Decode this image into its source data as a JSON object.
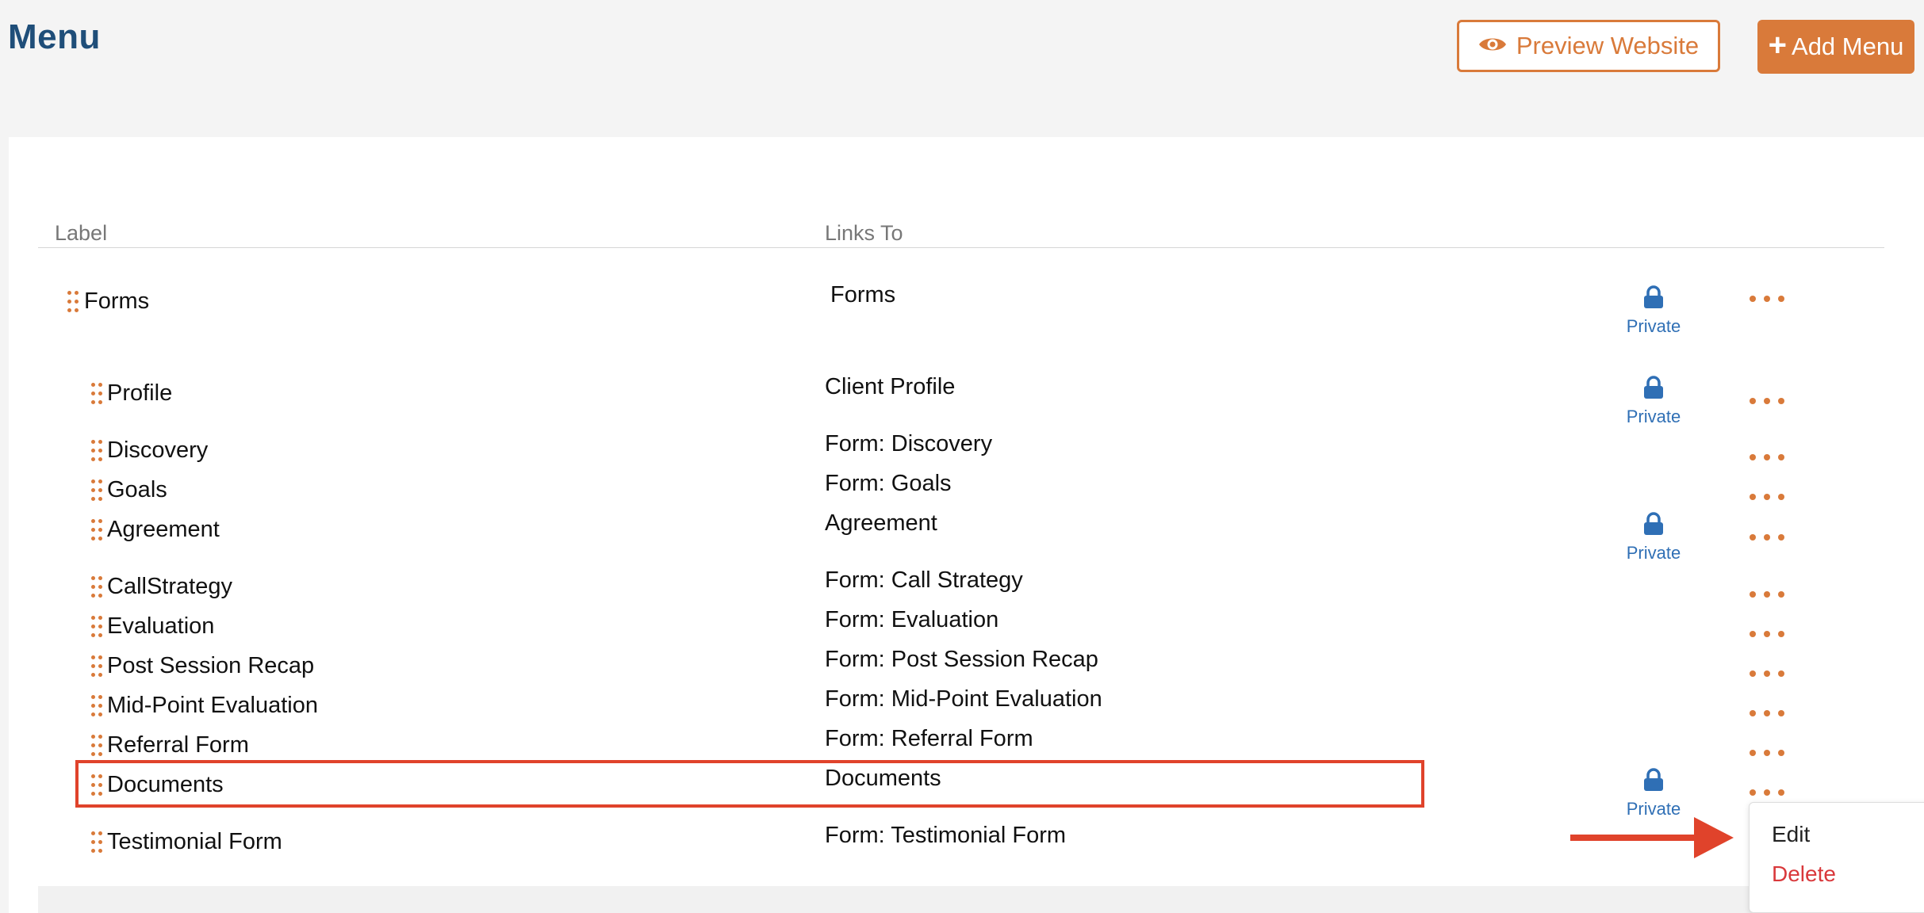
{
  "page": {
    "title": "Menu"
  },
  "header": {
    "preview_label": "Preview Website",
    "add_label": "Add Menu",
    "add_symbol": "+"
  },
  "table": {
    "columns": {
      "label": "Label",
      "links_to": "Links To"
    },
    "private_label": "Private",
    "rows": [
      {
        "label": "Forms",
        "links_to": "Forms",
        "private": true
      },
      {
        "label": "Profile",
        "links_to": "Client Profile",
        "private": true
      },
      {
        "label": "Discovery",
        "links_to": "Form: Discovery",
        "private": false
      },
      {
        "label": "Goals",
        "links_to": "Form: Goals",
        "private": false
      },
      {
        "label": "Agreement",
        "links_to": "Agreement",
        "private": true
      },
      {
        "label": "CallStrategy",
        "links_to": "Form: Call Strategy",
        "private": false
      },
      {
        "label": "Evaluation",
        "links_to": "Form: Evaluation",
        "private": false
      },
      {
        "label": "Post Session Recap",
        "links_to": "Form: Post Session Recap",
        "private": false
      },
      {
        "label": "Mid-Point Evaluation",
        "links_to": "Form: Mid-Point Evaluation",
        "private": false
      },
      {
        "label": "Referral Form",
        "links_to": "Form: Referral Form",
        "private": false
      },
      {
        "label": "Documents",
        "links_to": "Documents",
        "private": true
      },
      {
        "label": "Testimonial Form",
        "links_to": "Form: Testimonial Form",
        "private": false
      }
    ]
  },
  "context_menu": {
    "edit": "Edit",
    "delete": "Delete"
  },
  "colors": {
    "accent": "#d97a3a",
    "title": "#1f4e79",
    "private": "#2f6fb5",
    "highlight": "#e0432b",
    "delete": "#d9383b"
  },
  "icons": {
    "preview": "eye-icon",
    "private": "lock-icon",
    "row_menu": "more-horizontal-icon",
    "drag": "drag-handle-icon"
  }
}
